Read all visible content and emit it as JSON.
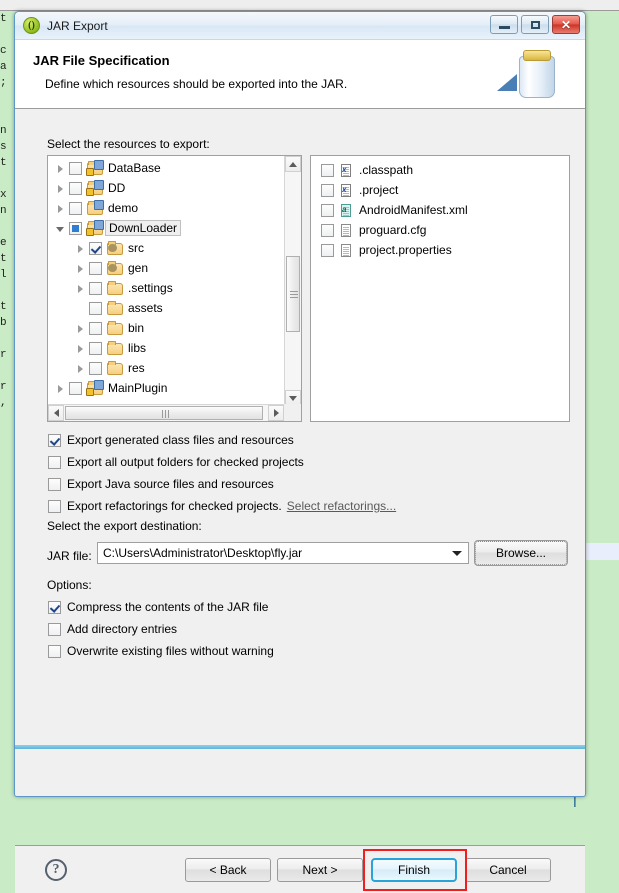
{
  "background": {
    "code_sliver": "t\n\nc\na\n;\n\n\nn\ns\nt\n\nx\nn\n\ne\nt\nl\n\nt\nb\n\nr\n\nr\n,"
  },
  "window": {
    "title": "JAR Export",
    "app_icon": "jar-app-icon",
    "minimize_label": "Minimize",
    "maximize_label": "Maximize",
    "close_label": "Close",
    "close_glyph": "✕"
  },
  "header": {
    "title": "JAR File Specification",
    "subtitle": "Define which resources should be exported into the JAR.",
    "banner_icon": "jar-banner-icon"
  },
  "resources": {
    "label": "Select the resources to export:",
    "tree": [
      {
        "label": "DataBase",
        "indent": 0,
        "arrow": "closed",
        "checkbox": "unchecked",
        "icon": "project-folder-icon",
        "selected": false
      },
      {
        "label": "DD",
        "indent": 0,
        "arrow": "closed",
        "checkbox": "unchecked",
        "icon": "project-folder-icon",
        "selected": false
      },
      {
        "label": "demo",
        "indent": 0,
        "arrow": "closed",
        "checkbox": "unchecked",
        "icon": "project-folder-icon",
        "selected": false
      },
      {
        "label": "DownLoader",
        "indent": 0,
        "arrow": "open",
        "checkbox": "partial",
        "icon": "project-folder-icon",
        "selected": true
      },
      {
        "label": "src",
        "indent": 1,
        "arrow": "closed",
        "checkbox": "checked",
        "icon": "source-folder-icon",
        "selected": false
      },
      {
        "label": "gen",
        "indent": 1,
        "arrow": "closed",
        "checkbox": "unchecked",
        "icon": "source-folder-icon",
        "selected": false
      },
      {
        "label": ".settings",
        "indent": 1,
        "arrow": "closed",
        "checkbox": "unchecked",
        "icon": "folder-icon",
        "selected": false
      },
      {
        "label": "assets",
        "indent": 1,
        "arrow": "none",
        "checkbox": "unchecked",
        "icon": "folder-icon",
        "selected": false
      },
      {
        "label": "bin",
        "indent": 1,
        "arrow": "closed",
        "checkbox": "unchecked",
        "icon": "folder-icon",
        "selected": false
      },
      {
        "label": "libs",
        "indent": 1,
        "arrow": "closed",
        "checkbox": "unchecked",
        "icon": "folder-icon",
        "selected": false
      },
      {
        "label": "res",
        "indent": 1,
        "arrow": "closed",
        "checkbox": "unchecked",
        "icon": "folder-icon",
        "selected": false
      },
      {
        "label": "MainPlugin",
        "indent": 0,
        "arrow": "closed",
        "checkbox": "unchecked",
        "icon": "project-folder-icon",
        "selected": false
      }
    ],
    "files": [
      {
        "label": ".classpath",
        "checkbox": "unchecked",
        "icon": "xml-file-icon",
        "mark": "x"
      },
      {
        "label": ".project",
        "checkbox": "unchecked",
        "icon": "xml-file-icon",
        "mark": "x"
      },
      {
        "label": "AndroidManifest.xml",
        "checkbox": "unchecked",
        "icon": "android-xml-icon",
        "mark": "a"
      },
      {
        "label": "proguard.cfg",
        "checkbox": "unchecked",
        "icon": "text-file-icon",
        "mark": ""
      },
      {
        "label": "project.properties",
        "checkbox": "unchecked",
        "icon": "text-file-icon",
        "mark": ""
      }
    ]
  },
  "export_options": [
    {
      "label": "Export generated class files and resources",
      "checked": true,
      "link": ""
    },
    {
      "label": "Export all output folders for checked projects",
      "checked": false,
      "link": ""
    },
    {
      "label": "Export Java source files and resources",
      "checked": false,
      "link": ""
    },
    {
      "label": "Export refactorings for checked projects.",
      "checked": false,
      "link": "Select refactorings..."
    }
  ],
  "destination": {
    "label": "Select the export destination:",
    "field_label": "JAR file:",
    "path_value": "C:\\Users\\Administrator\\Desktop\\fly.jar",
    "browse_label": "Browse..."
  },
  "options": {
    "label": "Options:",
    "items": [
      {
        "label": "Compress the contents of the JAR file",
        "checked": true
      },
      {
        "label": "Add directory entries",
        "checked": false
      },
      {
        "label": "Overwrite existing files without warning",
        "checked": false
      }
    ]
  },
  "footer": {
    "help_glyph": "?",
    "back_label": "< Back",
    "next_label": "Next >",
    "finish_label": "Finish",
    "cancel_label": "Cancel"
  },
  "colors": {
    "dialog_bg": "#f0f0f0",
    "title_border": "#5b97c9",
    "focus_blue": "#2aa3d8",
    "annotation_red": "#f01e1e",
    "editor_green": "#c9ecc6"
  }
}
